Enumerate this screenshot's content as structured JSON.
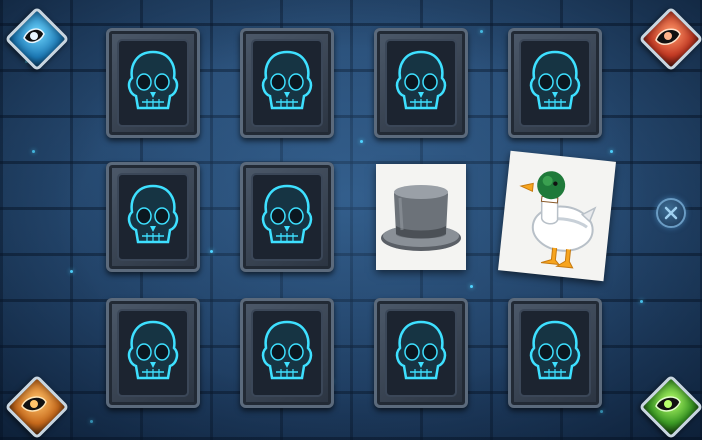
{
  "board": {
    "cards": [
      {
        "id": "r1c1",
        "state": "face-down",
        "face": "skull-icon"
      },
      {
        "id": "r1c2",
        "state": "face-down",
        "face": "skull-icon"
      },
      {
        "id": "r1c3",
        "state": "face-down",
        "face": "skull-icon"
      },
      {
        "id": "r1c4",
        "state": "face-down",
        "face": "skull-icon"
      },
      {
        "id": "r2c1",
        "state": "face-down",
        "face": "skull-icon"
      },
      {
        "id": "r2c2",
        "state": "face-down",
        "face": "skull-icon"
      },
      {
        "id": "r2c3",
        "state": "face-up",
        "face": "top-hat-icon"
      },
      {
        "id": "r2c4",
        "state": "face-up",
        "face": "duck-icon"
      },
      {
        "id": "r3c1",
        "state": "face-down",
        "face": "skull-icon"
      },
      {
        "id": "r3c2",
        "state": "face-down",
        "face": "skull-icon"
      },
      {
        "id": "r3c3",
        "state": "face-down",
        "face": "skull-icon"
      },
      {
        "id": "r3c4",
        "state": "face-down",
        "face": "skull-icon"
      }
    ]
  },
  "corners": [
    {
      "position": "top-left",
      "color": "blue",
      "icon": "eye-icon"
    },
    {
      "position": "top-right",
      "color": "red",
      "icon": "eye-icon"
    },
    {
      "position": "bottom-left",
      "color": "orange",
      "icon": "eye-icon"
    },
    {
      "position": "bottom-right",
      "color": "green",
      "icon": "eye-icon"
    }
  ],
  "close_button": {
    "icon": "close-icon"
  },
  "colors": {
    "wall": "#23456b",
    "glow": "#4fd3ff",
    "card_back": "#2f3a48"
  }
}
